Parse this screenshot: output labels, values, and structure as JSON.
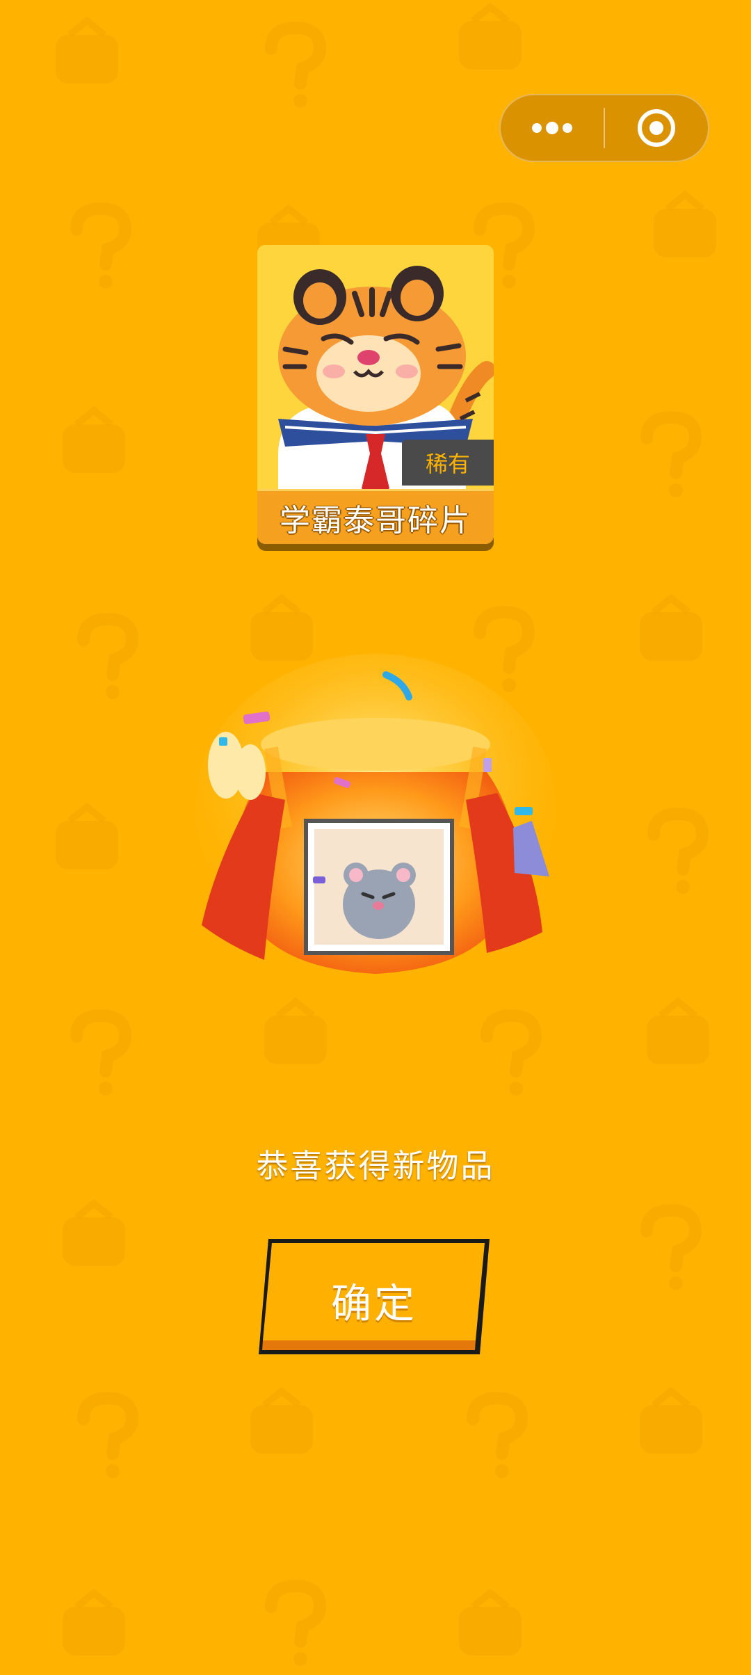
{
  "colors": {
    "background": "#FFB200",
    "card_background": "#FFD53D",
    "badge_background": "#4A4A4A",
    "badge_text": "#FFB300",
    "button_fill": "#FFB000",
    "button_outline": "#1A1A1A"
  },
  "menu": {
    "more_icon": "ellipsis-icon",
    "close_icon": "target-circle-icon"
  },
  "reward": {
    "rarity": "稀有",
    "name": "学霸泰哥碎片"
  },
  "message": "恭喜获得新物品",
  "confirm_label": "确定"
}
